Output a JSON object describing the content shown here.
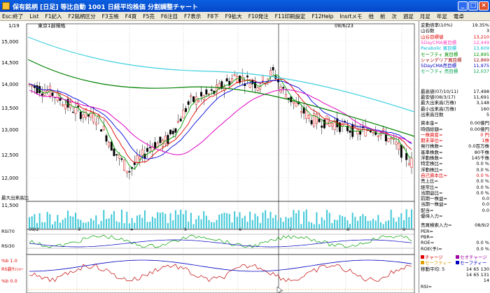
{
  "window": {
    "title": "保有銘柄 [日足] 等比自動  1001  日経平均株価 分割調整チャート",
    "buttons": [
      "_",
      "□",
      "×"
    ]
  },
  "menu": [
    "Esc:終了",
    "List",
    "F1記入",
    "F2銘柄区分",
    "F3玉帳",
    "F4買",
    "F5売",
    "F6注目",
    "F7表示",
    "F8下",
    "F9拡大",
    "F10発注",
    "F11印刷設定",
    "F12Help",
    "Insrtメモ",
    "他",
    "前",
    "次",
    "週足",
    "月足",
    "年足",
    "電卓"
  ],
  "chart": {
    "page_indicator": "1/19",
    "market_label": "東京1部規格",
    "date_readout": "08/6/23",
    "rsi_readout": "RSI新ｻﾝｼｬｰ 軌:0.09, 21:-0.36, 21:-0.39.90",
    "price_ticks": [
      "15,000",
      "14,500",
      "14,000",
      "13,500",
      "13,000",
      "12,500",
      "12,000"
    ],
    "volume_label": "最大出来高比",
    "volume_tick": "11,500",
    "month_labels": [
      "08/2",
      "3",
      "4",
      "5",
      "6",
      "7",
      "8",
      "9"
    ],
    "rsi_labels": [
      "RSI70",
      "RSI30"
    ],
    "lower_labels": [
      "%b  1.0",
      "RS新ｻﾝｼｬｰ",
      "%b  0.0"
    ],
    "colors": {
      "candle_up": "#e00000",
      "candle_down": "#000000",
      "ma_short": "#00a000",
      "ma_mid": "#e00000",
      "ma_long": "#008000",
      "ma_parabolic": "#40d0e0",
      "ma_pink": "#e000c0",
      "ma_blue": "#0000e0",
      "volume": "#40c8d8"
    }
  },
  "panel": {
    "stats": [
      {
        "label": "変動倍率(10%)",
        "value": "19.35%",
        "cls": ""
      },
      {
        "label": "山谷数",
        "value": "3",
        "cls": ""
      },
      {
        "label": "山谷目標値",
        "value": "13,210",
        "cls": "red"
      },
      {
        "label": "5DayCMA買目標",
        "value": "12,449",
        "cls": "pink"
      },
      {
        "label": "Parabolic 買目標",
        "value": "13,609",
        "cls": "cyan"
      },
      {
        "label": "セーフティ 買目標",
        "value": "12,895",
        "cls": "green"
      },
      {
        "label": "シャンデリア買目標",
        "value": "12,869",
        "cls": "darkred"
      },
      {
        "label": "5DayCMA売目標",
        "value": "11,975",
        "cls": "navy"
      },
      {
        "label": "セーフティ 売目標",
        "value": "12,037",
        "cls": "lgreen"
      }
    ],
    "hilo": [
      {
        "label": "最高値(07/10/11)",
        "value": "17,498"
      },
      {
        "label": "最安値(08/3/17)",
        "value": "11,691"
      },
      {
        "label": "最大出来高(万株)",
        "value": "3,148"
      },
      {
        "label": "最小出来高(万株)",
        "value": "160"
      },
      {
        "label": "出来高日数",
        "value": "5"
      }
    ],
    "fund": [
      {
        "label": "資本金=",
        "value": "0.00億円",
        "cls": ""
      },
      {
        "label": "時価総額=",
        "value": "0.00億円",
        "cls": ""
      },
      {
        "label": "一株資産=",
        "value": "0 円",
        "cls": "red"
      },
      {
        "label": "期末単位=",
        "value": "1株",
        "cls": "red"
      },
      {
        "label": "発行株数=",
        "value": "0.0百万株",
        "cls": ""
      },
      {
        "label": "基準株数=",
        "value": "80千株",
        "cls": ""
      },
      {
        "label": "浮動株数=",
        "value": "145千株",
        "cls": ""
      },
      {
        "label": "特定株比=",
        "value": "0.0 %",
        "cls": ""
      },
      {
        "label": "浮動株比=",
        "value": "0.0 %",
        "cls": ""
      },
      {
        "label": "自己資本比=",
        "value": "0.0 %",
        "cls": "red"
      },
      {
        "label": "売上比=",
        "value": "0.0 %",
        "cls": ""
      },
      {
        "label": "経常比=",
        "value": "0.0 %",
        "cls": ""
      },
      {
        "label": "当期益比=",
        "value": "0.0 %",
        "cls": ""
      },
      {
        "label": "前期一株益=",
        "value": "0.0",
        "cls": ""
      },
      {
        "label": "当期一株益=",
        "value": "0.0",
        "cls": ""
      },
      {
        "label": "配当=",
        "value": "0.0",
        "cls": ""
      },
      {
        "label": "優待入力=",
        "value": "",
        "cls": ""
      }
    ],
    "valuation": [
      {
        "label": "売買検索入力=",
        "value": "08/9/2"
      },
      {
        "label": "PER=",
        "value": ""
      },
      {
        "label": "PBR=",
        "value": ""
      },
      {
        "label": "ROE=",
        "value": "0.0 %"
      },
      {
        "label": "ROE(予)=",
        "value": "0.0 %"
      }
    ],
    "legend": [
      {
        "label": "チャージ",
        "color": "#e00000"
      },
      {
        "label": "セオチャージ",
        "color": "#a000a0"
      },
      {
        "label": "セーフティー",
        "color": "#e0a000"
      },
      {
        "label": "セーフティー",
        "color": "#0000c0"
      }
    ],
    "ma_row": {
      "label": "移動平均:",
      "v1": "5",
      "v2": "14",
      "v3": "65",
      "v4": "130"
    },
    "ma_row2": {
      "v2": "14",
      "v3": "65",
      "v4": "131"
    },
    "bottom": {
      "value": "14",
      "rsi_label": "RSI="
    }
  }
}
